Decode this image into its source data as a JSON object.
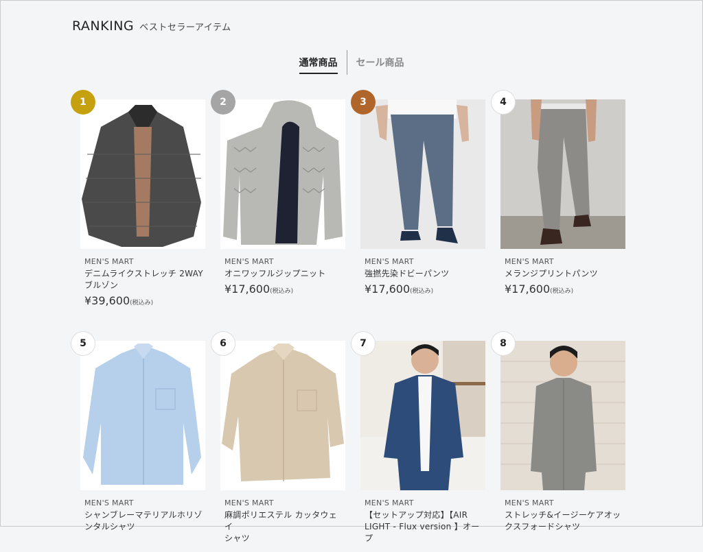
{
  "header": {
    "title": "RANKING",
    "subtitle": "ベストセラーアイテム"
  },
  "tabs": [
    {
      "label": "通常商品",
      "active": true
    },
    {
      "label": "セール商品",
      "active": false
    }
  ],
  "products": [
    {
      "rank": "1",
      "brand": "MEN'S MART",
      "name_lines": [
        "デニムライクストレッチ 2WAY",
        "ブルゾン"
      ],
      "price": "¥39,600",
      "tax": "(税込み)",
      "image": "jacket-photo"
    },
    {
      "rank": "2",
      "brand": "MEN'S MART",
      "name_lines": [
        "オニワッフルジップニット"
      ],
      "price": "¥17,600",
      "tax": "(税込み)",
      "image": "zip-hoodie-photo"
    },
    {
      "rank": "3",
      "brand": "MEN'S MART",
      "name_lines": [
        "強撚先染ドビーパンツ"
      ],
      "price": "¥17,600",
      "tax": "(税込み)",
      "image": "blue-pants-photo"
    },
    {
      "rank": "4",
      "brand": "MEN'S MART",
      "name_lines": [
        "メランジプリントパンツ"
      ],
      "price": "¥17,600",
      "tax": "(税込み)",
      "image": "gray-pants-photo"
    },
    {
      "rank": "5",
      "brand": "MEN'S MART",
      "name_lines": [
        "シャンブレーマテリアルホリゾ",
        "ンタルシャツ"
      ],
      "price": "",
      "tax": "",
      "image": "blue-shirt-photo"
    },
    {
      "rank": "6",
      "brand": "MEN'S MART",
      "name_lines": [
        "麻調ポリエステル カッタウェイ",
        "シャツ"
      ],
      "price": "",
      "tax": "",
      "image": "beige-shirt-photo"
    },
    {
      "rank": "7",
      "brand": "MEN'S MART",
      "name_lines": [
        "【セットアップ対応】【AIR",
        "LIGHT - Flux version 】オープ"
      ],
      "price": "",
      "tax": "",
      "image": "navy-shirt-model-photo"
    },
    {
      "rank": "8",
      "brand": "MEN'S MART",
      "name_lines": [
        "ストレッチ&イージーケアオッ",
        "クスフォードシャツ"
      ],
      "price": "",
      "tax": "",
      "image": "gray-shirt-model-photo"
    }
  ]
}
